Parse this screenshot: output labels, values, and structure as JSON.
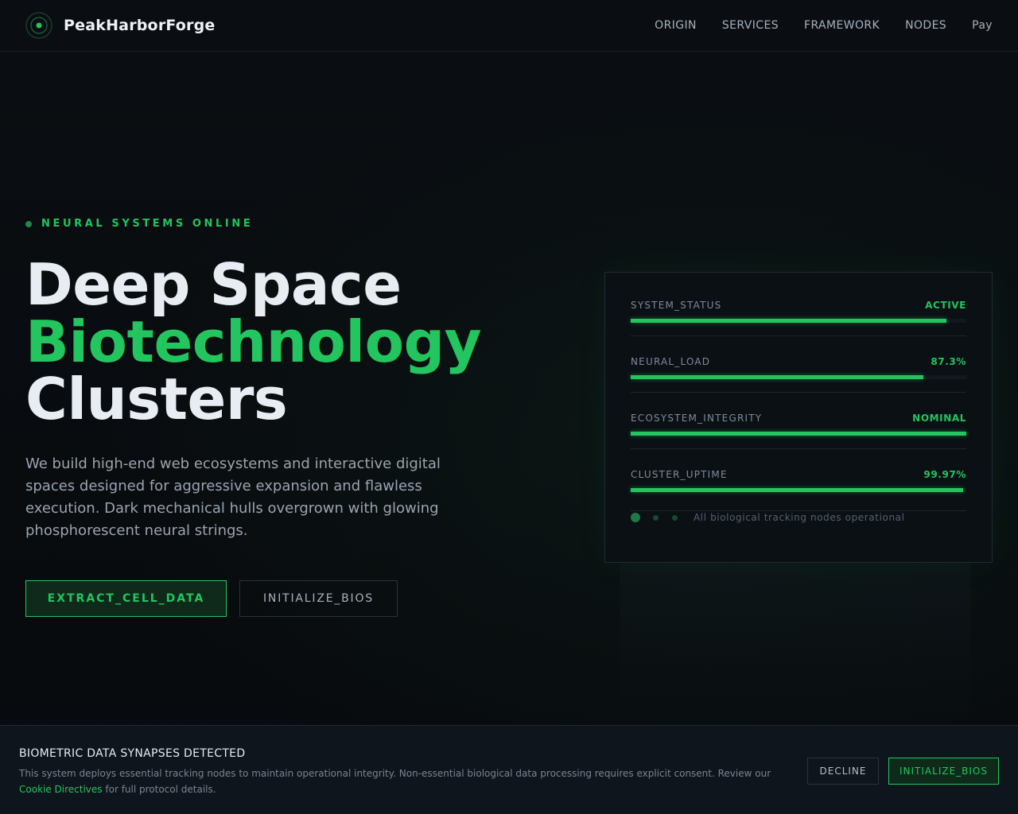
{
  "header": {
    "brand": "PeakHarborForge",
    "logo_icon": "radar-target-icon",
    "nav": [
      "ORIGIN",
      "SERVICES",
      "FRAMEWORK",
      "NODES",
      "Pay"
    ]
  },
  "hero": {
    "status": "NEURAL SYSTEMS ONLINE",
    "title_line1": "Deep Space",
    "title_line2": "Biotechnology",
    "title_line3": "Clusters",
    "description": "We build high-end web ecosystems and interactive digital spaces designed for aggressive expansion and flawless execution. Dark mechanical hulls overgrown with glowing phosphorescent neural strings.",
    "primary_button": "EXTRACT_CELL_DATA",
    "secondary_button": "INITIALIZE_BIOS"
  },
  "panel": {
    "metrics": [
      {
        "label": "SYSTEM_STATUS",
        "value": "ACTIVE",
        "level": 0.94
      },
      {
        "label": "NEURAL_LOAD",
        "value": "87.3%",
        "level": 0.873
      },
      {
        "label": "ECOSYSTEM_INTEGRITY",
        "value": "NOMINAL",
        "level": 1.0
      },
      {
        "label": "CLUSTER_UPTIME",
        "value": "99.97%",
        "level": 0.99
      }
    ],
    "footer": "All biological tracking nodes operational"
  },
  "cookie": {
    "title": "BIOMETRIC DATA SYNAPSES DETECTED",
    "text_before": "This system deploys essential tracking nodes to maintain operational integrity. Non-essential biological data processing requires explicit consent. Review our",
    "link": "Cookie Directives",
    "text_after": "for full protocol details.",
    "decline": "DECLINE",
    "accept": "INITIALIZE_BIOS"
  },
  "colors": {
    "accent": "#22c55e",
    "background": "#080b0f",
    "panel": "#0b1015"
  }
}
